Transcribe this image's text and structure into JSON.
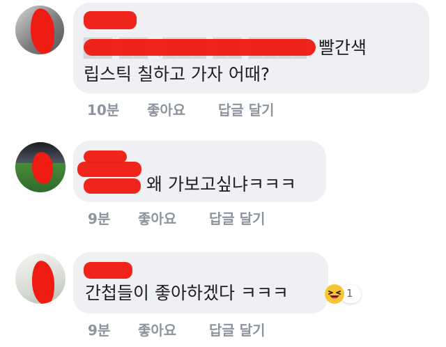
{
  "comments": [
    {
      "text_line_1": "빨간색",
      "text_line_2": "립스틱 칠하고 가자 어때?",
      "time": "10분",
      "like_label": "좋아요",
      "reply_label": "답글 달기"
    },
    {
      "text": "왜 가보고싶냐ㅋㅋㅋ",
      "time": "9분",
      "like_label": "좋아요",
      "reply_label": "답글 달기"
    },
    {
      "text": "간첩들이 좋아하겠다 ㅋㅋㅋ",
      "time": "9분",
      "like_label": "좋아요",
      "reply_label": "답글 달기",
      "reaction_icon": "laughing-face-icon",
      "reaction_count": "1"
    }
  ],
  "colors": {
    "bubble": "#eef0f3",
    "text": "#1c1e21",
    "meta": "#8d949e",
    "redaction": "#ee1c12"
  }
}
